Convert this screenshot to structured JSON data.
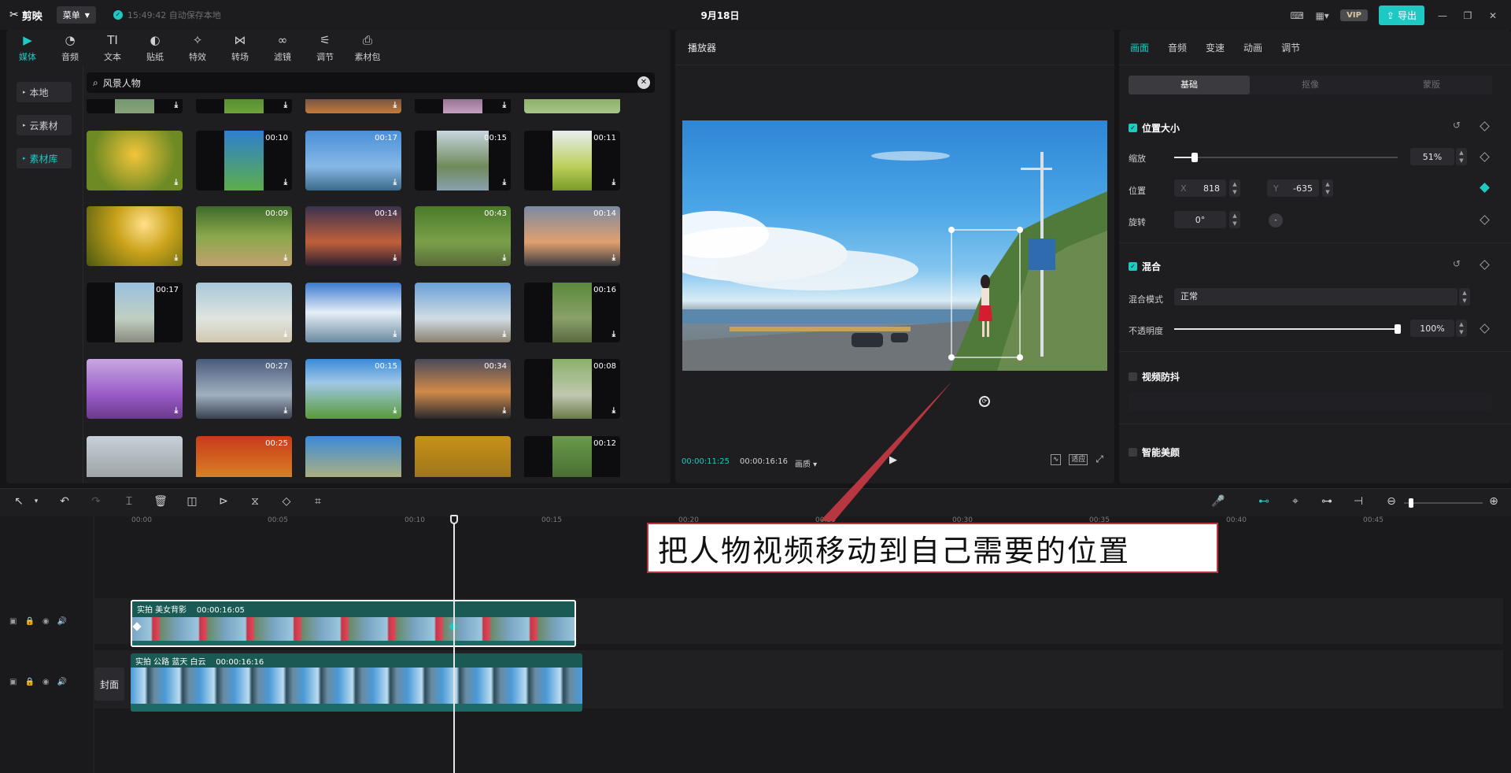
{
  "topbar": {
    "app_name": "剪映",
    "menu_label": "菜单",
    "autosave_text": "15:49:42 自动保存本地",
    "project_title": "9月18日",
    "vip_label": "VIP",
    "export_label": "导出"
  },
  "media": {
    "tools": [
      {
        "label": "媒体",
        "icon": "media-icon"
      },
      {
        "label": "音频",
        "icon": "audio-icon"
      },
      {
        "label": "文本",
        "icon": "text-icon"
      },
      {
        "label": "贴纸",
        "icon": "sticker-icon"
      },
      {
        "label": "特效",
        "icon": "effects-icon"
      },
      {
        "label": "转场",
        "icon": "transition-icon"
      },
      {
        "label": "滤镜",
        "icon": "filter-icon"
      },
      {
        "label": "调节",
        "icon": "adjust-icon"
      },
      {
        "label": "素材包",
        "icon": "package-icon"
      }
    ],
    "side": {
      "local": "本地",
      "cloud": "云素材",
      "library": "素材库"
    },
    "search_query": "风景人物",
    "thumb_durations": {
      "r1c2": "00:10",
      "r1c3": "00:17",
      "r1c4": "00:15",
      "r1c5": "00:11",
      "r2c2": "00:09",
      "r2c3": "00:14",
      "r2c4": "00:43",
      "r2c5": "00:14",
      "r3c1": "00:17",
      "r3c5": "00:16",
      "r4c2": "00:27",
      "r4c3": "00:15",
      "r4c4": "00:34",
      "r4c5": "00:08",
      "r5c2": "00:25",
      "r5c5": "00:12"
    }
  },
  "player": {
    "header": "播放器",
    "current_time": "00:00:11:25",
    "total_time": "00:00:16:16",
    "quality_label": "画质",
    "ratio_label": "适应"
  },
  "props": {
    "tabs": [
      "画面",
      "音频",
      "变速",
      "动画",
      "调节"
    ],
    "segments": [
      "基础",
      "抠像",
      "蒙版"
    ],
    "position_size_title": "位置大小",
    "scale_label": "缩放",
    "scale_value": "51%",
    "scale_fraction": 0.09,
    "position_label": "位置",
    "pos_x_prefix": "X",
    "pos_x": "818",
    "pos_y_prefix": "Y",
    "pos_y": "-635",
    "rotation_label": "旋转",
    "rotation_value": "0°",
    "blend_title": "混合",
    "blend_mode_label": "混合模式",
    "blend_mode_value": "正常",
    "opacity_label": "不透明度",
    "opacity_value": "100%",
    "opacity_fraction": 1.0,
    "stabilize_title": "视频防抖",
    "beauty_title": "智能美颜"
  },
  "timeline": {
    "ruler_labels": [
      "00:00",
      "00:05",
      "00:10",
      "00:15",
      "00:20",
      "00:25",
      "00:30",
      "00:35",
      "00:40",
      "00:45"
    ],
    "cover_label": "封面",
    "clip1": {
      "name": "实拍 美女背影",
      "duration": "00:00:16:05"
    },
    "clip2": {
      "name": "实拍 公路 蓝天 白云",
      "duration": "00:00:16:16"
    }
  },
  "annotation": {
    "text": "把人物视频移动到自己需要的位置",
    "color": "#b83640"
  },
  "colors": {
    "accent": "#1fc9c3"
  }
}
